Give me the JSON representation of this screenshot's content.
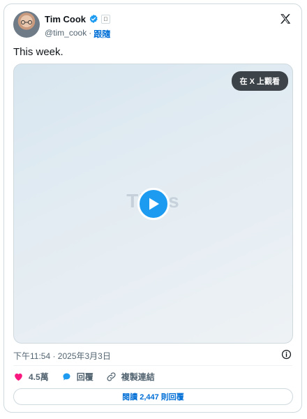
{
  "author": {
    "display_name": "Tim Cook",
    "handle": "@tim_cook",
    "separator": "·",
    "follow_label": "跟隨"
  },
  "tweet": {
    "text": "This week.",
    "timestamp": "下午11:54 · 2025年3月3日"
  },
  "media": {
    "view_on_x_label": "在 X 上觀看",
    "watermark_text": "Tim's"
  },
  "actions": {
    "likes": "4.5萬",
    "reply_label": "回覆",
    "copy_link_label": "複製連結"
  },
  "read_replies_label": "閱讀 2,447 則回覆",
  "colors": {
    "accent": "#1d9bf0",
    "link": "#006fd6",
    "like": "#f91880",
    "text": "#0f1419",
    "muted": "#536471"
  }
}
